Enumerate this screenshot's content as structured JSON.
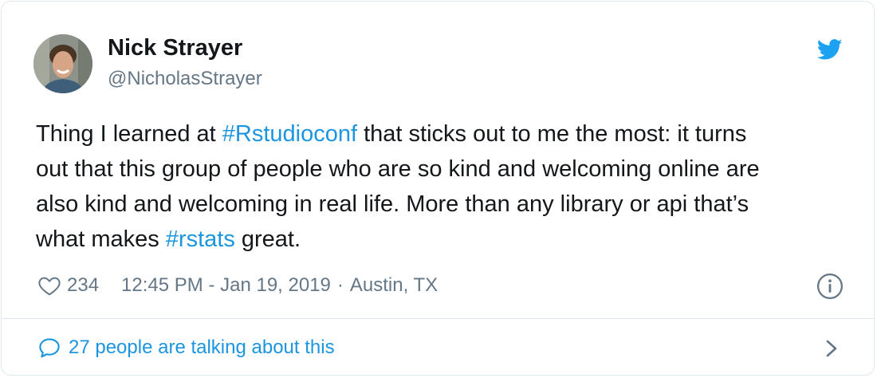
{
  "tweet": {
    "author_name": "Nick Strayer",
    "author_handle": "@NicholasStrayer",
    "text_lines": [
      [
        {
          "text": "Thing I learned at ",
          "tag": false
        },
        {
          "text": "#Rstudioconf",
          "tag": true
        },
        {
          "text": " that sticks out to me the most: it turns",
          "tag": false
        }
      ],
      [
        {
          "text": "out that this group of people who are so kind and welcoming online are",
          "tag": false
        }
      ],
      [
        {
          "text": "also kind and welcoming in real life. More than any library or api that’s",
          "tag": false
        }
      ],
      [
        {
          "text": "what makes ",
          "tag": false
        },
        {
          "text": "#rstats",
          "tag": true
        },
        {
          "text": " great.",
          "tag": false
        }
      ]
    ],
    "like_count": "234",
    "timestamp": "12:45 PM - Jan 19, 2019",
    "separator": "·",
    "location": "Austin, TX",
    "conversation_label": "27 people are talking about this"
  },
  "colors": {
    "link": "#1b95e0",
    "muted": "#657786",
    "text": "#14171a",
    "border": "#e1e8ed"
  },
  "icons": {
    "brand": "twitter-bird-icon",
    "like": "heart-icon",
    "info": "info-icon",
    "reply": "speech-bubble-icon",
    "more": "chevron-right-icon"
  }
}
